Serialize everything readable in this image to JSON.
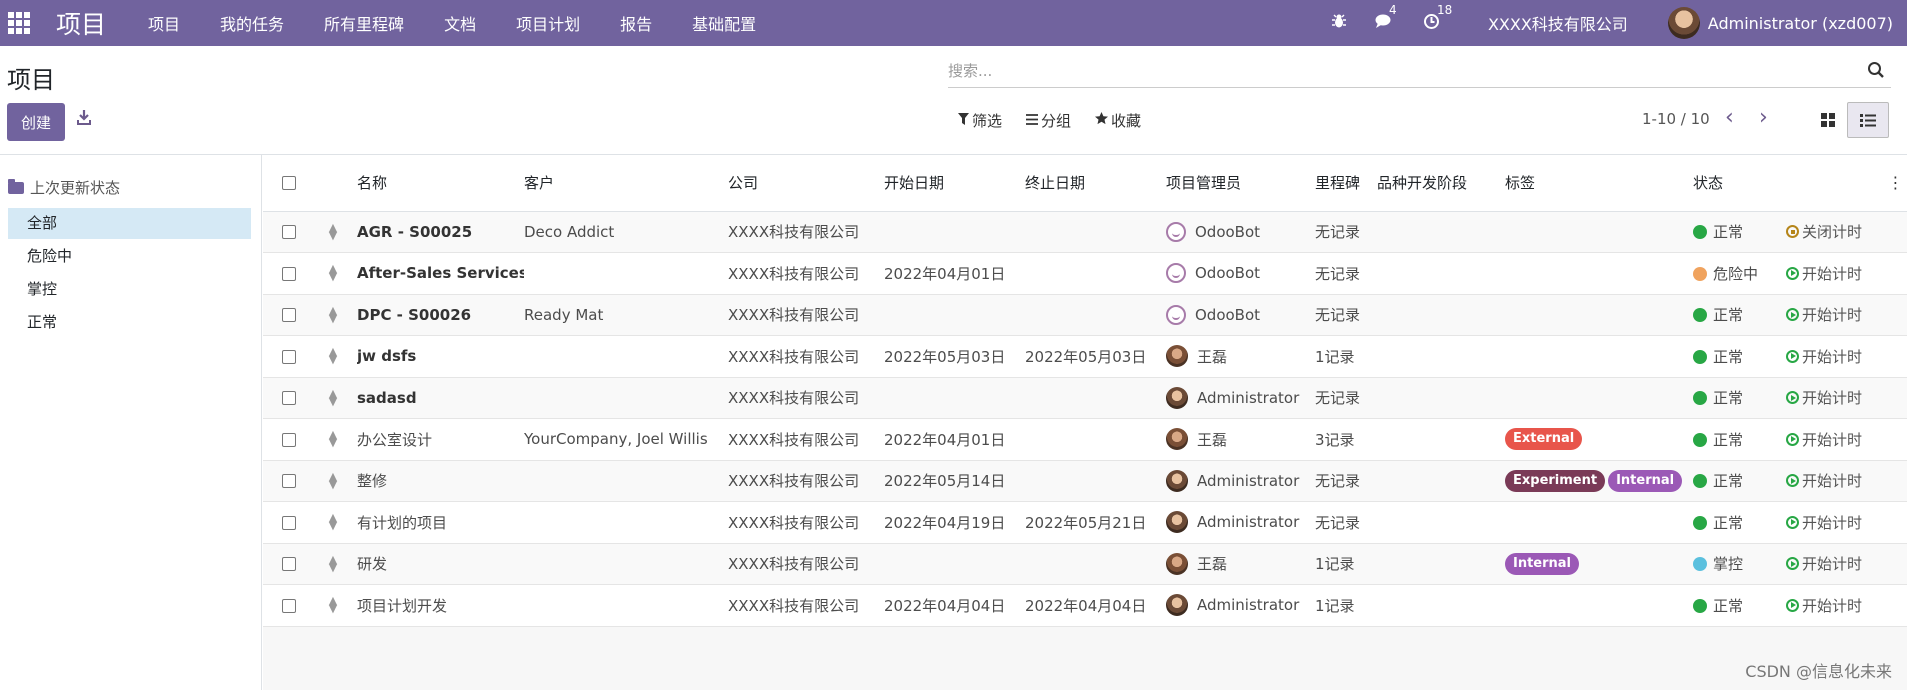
{
  "navbar": {
    "brand": "项目",
    "menu": [
      "项目",
      "我的任务",
      "所有里程碑",
      "文档",
      "项目计划",
      "报告",
      "基础配置"
    ],
    "messages_count": "4",
    "activities_count": "18",
    "company": "XXXX科技有限公司",
    "user": "Administrator (xzd007)"
  },
  "control": {
    "title": "项目",
    "create_label": "创建",
    "search_placeholder": "搜索...",
    "filter_label": "筛选",
    "group_label": "分组",
    "favorite_label": "收藏",
    "pager": "1-10 / 10"
  },
  "sidebar": {
    "header": "上次更新状态",
    "items": [
      "全部",
      "危险中",
      "掌控",
      "正常"
    ],
    "active_index": 0
  },
  "table": {
    "headers": [
      "名称",
      "客户",
      "公司",
      "开始日期",
      "终止日期",
      "项目管理员",
      "里程碑",
      "品种开发阶段",
      "标签",
      "状态"
    ],
    "rows": [
      {
        "name": "AGR - S00025",
        "bold": true,
        "customer": "Deco Addict",
        "company": "XXXX科技有限公司",
        "start": "",
        "end": "",
        "manager": "OdooBot",
        "manager_icon": "bot",
        "milestone": "无记录",
        "stage": "",
        "tags": [],
        "status": "正常",
        "status_color": "#28a745",
        "timer": "关闭计时",
        "timer_type": "stop"
      },
      {
        "name": "After-Sales Services",
        "bold": true,
        "customer": "",
        "company": "XXXX科技有限公司",
        "start": "2022年04月01日",
        "end": "",
        "manager": "OdooBot",
        "manager_icon": "bot",
        "milestone": "无记录",
        "stage": "",
        "tags": [],
        "status": "危险中",
        "status_color": "#f0a35e",
        "timer": "开始计时",
        "timer_type": "play"
      },
      {
        "name": "DPC - S00026",
        "bold": true,
        "customer": "Ready Mat",
        "company": "XXXX科技有限公司",
        "start": "",
        "end": "",
        "manager": "OdooBot",
        "manager_icon": "bot",
        "milestone": "无记录",
        "stage": "",
        "tags": [],
        "status": "正常",
        "status_color": "#28a745",
        "timer": "开始计时",
        "timer_type": "play"
      },
      {
        "name": "jw dsfs",
        "bold": true,
        "customer": "",
        "company": "XXXX科技有限公司",
        "start": "2022年05月03日",
        "end": "2022年05月03日",
        "manager": "王磊",
        "manager_icon": "person",
        "milestone": "1记录",
        "stage": "",
        "tags": [],
        "status": "正常",
        "status_color": "#28a745",
        "timer": "开始计时",
        "timer_type": "play"
      },
      {
        "name": "sadasd",
        "bold": true,
        "customer": "",
        "company": "XXXX科技有限公司",
        "start": "",
        "end": "",
        "manager": "Administrator",
        "manager_icon": "admin",
        "milestone": "无记录",
        "stage": "",
        "tags": [],
        "status": "正常",
        "status_color": "#28a745",
        "timer": "开始计时",
        "timer_type": "play"
      },
      {
        "name": "办公室设计",
        "bold": false,
        "customer": "YourCompany, Joel Willis",
        "company": "XXXX科技有限公司",
        "start": "2022年04月01日",
        "end": "",
        "manager": "王磊",
        "manager_icon": "person",
        "milestone": "3记录",
        "stage": "",
        "tags": [
          {
            "label": "External",
            "color": "#e8554b"
          }
        ],
        "status": "正常",
        "status_color": "#28a745",
        "timer": "开始计时",
        "timer_type": "play"
      },
      {
        "name": "整修",
        "bold": false,
        "customer": "",
        "company": "XXXX科技有限公司",
        "start": "2022年05月14日",
        "end": "",
        "manager": "Administrator",
        "manager_icon": "admin",
        "milestone": "无记录",
        "stage": "",
        "tags": [
          {
            "label": "Experiment",
            "color": "#7a3a57"
          },
          {
            "label": "Internal",
            "color": "#9b59b6"
          }
        ],
        "status": "正常",
        "status_color": "#28a745",
        "timer": "开始计时",
        "timer_type": "play"
      },
      {
        "name": "有计划的项目",
        "bold": false,
        "customer": "",
        "company": "XXXX科技有限公司",
        "start": "2022年04月19日",
        "end": "2022年05月21日",
        "manager": "Administrator",
        "manager_icon": "admin",
        "milestone": "无记录",
        "stage": "",
        "tags": [],
        "status": "正常",
        "status_color": "#28a745",
        "timer": "开始计时",
        "timer_type": "play"
      },
      {
        "name": "研发",
        "bold": false,
        "customer": "",
        "company": "XXXX科技有限公司",
        "start": "",
        "end": "",
        "manager": "王磊",
        "manager_icon": "person",
        "milestone": "1记录",
        "stage": "",
        "tags": [
          {
            "label": "Internal",
            "color": "#9b59b6"
          }
        ],
        "status": "掌控",
        "status_color": "#5bc0de",
        "timer": "开始计时",
        "timer_type": "play"
      },
      {
        "name": "项目计划开发",
        "bold": false,
        "customer": "",
        "company": "XXXX科技有限公司",
        "start": "2022年04月04日",
        "end": "2022年04月04日",
        "manager": "Administrator",
        "manager_icon": "admin",
        "milestone": "1记录",
        "stage": "",
        "tags": [],
        "status": "正常",
        "status_color": "#28a745",
        "timer": "开始计时",
        "timer_type": "play"
      }
    ]
  },
  "watermark": "CSDN @信息化未来",
  "colors": {
    "brand": "#71639e"
  }
}
